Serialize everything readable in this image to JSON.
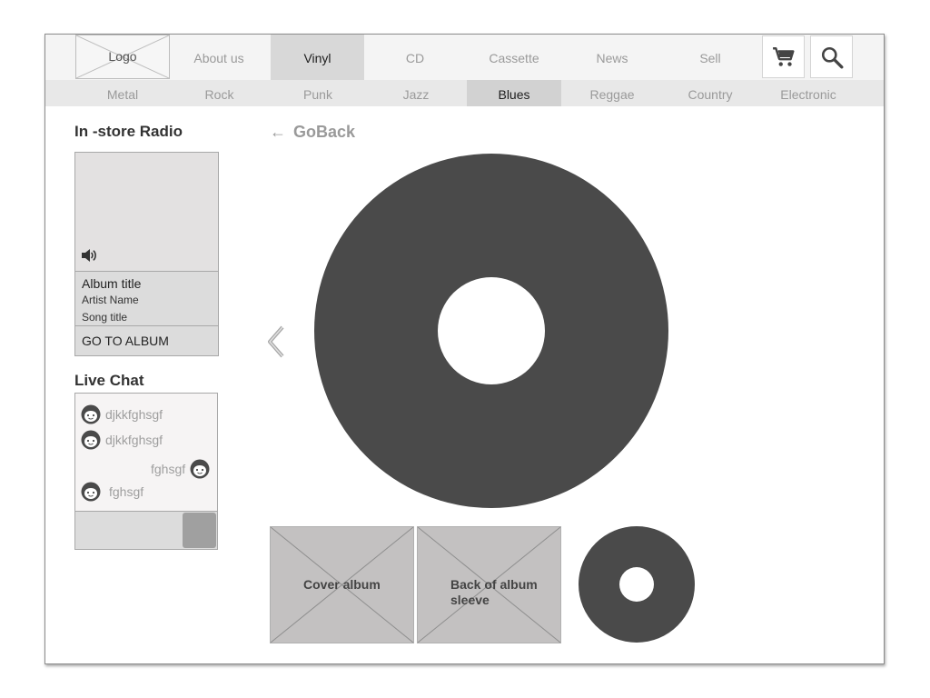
{
  "header": {
    "logo": "Logo",
    "nav": [
      {
        "label": "About us",
        "active": false
      },
      {
        "label": "Vinyl",
        "active": true
      },
      {
        "label": "CD",
        "active": false
      },
      {
        "label": "Cassette",
        "active": false
      },
      {
        "label": "News",
        "active": false
      },
      {
        "label": "Sell",
        "active": false
      }
    ],
    "icons": [
      "cart-icon",
      "search-icon"
    ]
  },
  "genres": [
    {
      "label": "Metal",
      "active": false
    },
    {
      "label": "Rock",
      "active": false
    },
    {
      "label": "Punk",
      "active": false
    },
    {
      "label": "Jazz",
      "active": false
    },
    {
      "label": "Blues",
      "active": true
    },
    {
      "label": "Reggae",
      "active": false
    },
    {
      "label": "Country",
      "active": false
    },
    {
      "label": "Electronic",
      "active": false
    }
  ],
  "radio": {
    "heading": "In -store Radio",
    "album_title": "Album title",
    "artist": "Artist Name",
    "song": "Song title",
    "go_to_album": "GO TO ALBUM",
    "icon": "speaker-icon"
  },
  "chat": {
    "heading": "Live Chat",
    "messages": [
      {
        "text": "djkkfghsgf",
        "side": "left"
      },
      {
        "text": "djkkfghsgf",
        "side": "left"
      },
      {
        "text": "fghsgf",
        "side": "right"
      },
      {
        "text": "fghsgf",
        "side": "left"
      }
    ]
  },
  "main": {
    "goback_arrow": "←",
    "goback": "GoBack",
    "thumbs": [
      {
        "caption": "Cover album"
      },
      {
        "caption": "Back of album sleeve"
      }
    ]
  },
  "colors": {
    "vinyl": "#4a4a4a",
    "active_nav": "#d8d8d8",
    "placeholder": "#c3c1c1"
  }
}
